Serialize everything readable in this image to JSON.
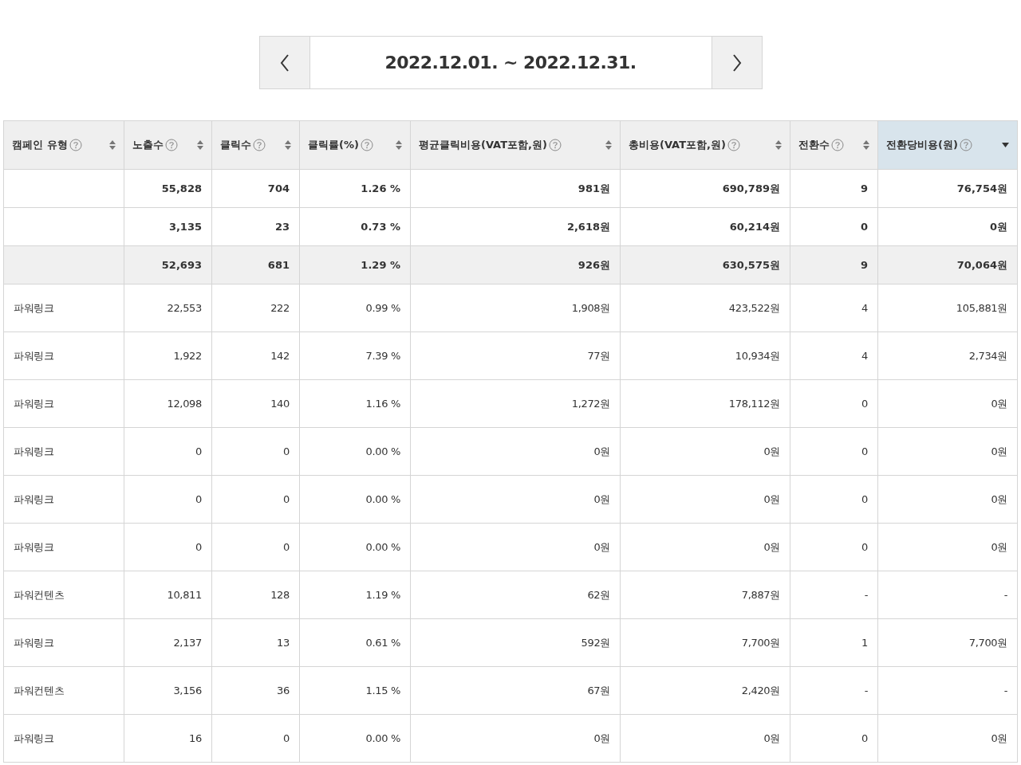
{
  "date_range": {
    "label": "2022.12.01. ~ 2022.12.31."
  },
  "table": {
    "columns": [
      {
        "label": "캠페인 유형",
        "sorted": false,
        "selected": false
      },
      {
        "label": "노출수",
        "sorted": false,
        "selected": false
      },
      {
        "label": "클릭수",
        "sorted": false,
        "selected": false
      },
      {
        "label": "클릭률(%)",
        "sorted": false,
        "selected": false
      },
      {
        "label": "평균클릭비용(VAT포함,원)",
        "sorted": false,
        "selected": false
      },
      {
        "label": "총비용(VAT포함,원)",
        "sorted": false,
        "selected": false
      },
      {
        "label": "전환수",
        "sorted": false,
        "selected": false
      },
      {
        "label": "전환당비용(원)",
        "sorted": true,
        "selected": true
      }
    ],
    "rows": [
      {
        "kind": "summary",
        "shaded": false,
        "cells": [
          "",
          "55,828",
          "704",
          "1.26 %",
          "981원",
          "690,789원",
          "9",
          "76,754원"
        ]
      },
      {
        "kind": "summary",
        "shaded": false,
        "cells": [
          "",
          "3,135",
          "23",
          "0.73 %",
          "2,618원",
          "60,214원",
          "0",
          "0원"
        ]
      },
      {
        "kind": "summary",
        "shaded": true,
        "cells": [
          "",
          "52,693",
          "681",
          "1.29 %",
          "926원",
          "630,575원",
          "9",
          "70,064원"
        ]
      },
      {
        "kind": "data",
        "shaded": false,
        "cells": [
          "파워링크",
          "22,553",
          "222",
          "0.99 %",
          "1,908원",
          "423,522원",
          "4",
          "105,881원"
        ]
      },
      {
        "kind": "data",
        "shaded": false,
        "cells": [
          "파워링크",
          "1,922",
          "142",
          "7.39 %",
          "77원",
          "10,934원",
          "4",
          "2,734원"
        ]
      },
      {
        "kind": "data",
        "shaded": false,
        "cells": [
          "파워링크",
          "12,098",
          "140",
          "1.16 %",
          "1,272원",
          "178,112원",
          "0",
          "0원"
        ]
      },
      {
        "kind": "data",
        "shaded": false,
        "cells": [
          "파워링크",
          "0",
          "0",
          "0.00 %",
          "0원",
          "0원",
          "0",
          "0원"
        ]
      },
      {
        "kind": "data",
        "shaded": false,
        "cells": [
          "파워링크",
          "0",
          "0",
          "0.00 %",
          "0원",
          "0원",
          "0",
          "0원"
        ]
      },
      {
        "kind": "data",
        "shaded": false,
        "cells": [
          "파워링크",
          "0",
          "0",
          "0.00 %",
          "0원",
          "0원",
          "0",
          "0원"
        ]
      },
      {
        "kind": "data",
        "shaded": false,
        "cells": [
          "파워컨텐츠",
          "10,811",
          "128",
          "1.19 %",
          "62원",
          "7,887원",
          "-",
          "-"
        ]
      },
      {
        "kind": "data",
        "shaded": false,
        "cells": [
          "파워링크",
          "2,137",
          "13",
          "0.61 %",
          "592원",
          "7,700원",
          "1",
          "7,700원"
        ]
      },
      {
        "kind": "data",
        "shaded": false,
        "cells": [
          "파워컨텐츠",
          "3,156",
          "36",
          "1.15 %",
          "67원",
          "2,420원",
          "-",
          "-"
        ]
      },
      {
        "kind": "data",
        "shaded": false,
        "cells": [
          "파워링크",
          "16",
          "0",
          "0.00 %",
          "0원",
          "0원",
          "0",
          "0원"
        ]
      }
    ]
  }
}
